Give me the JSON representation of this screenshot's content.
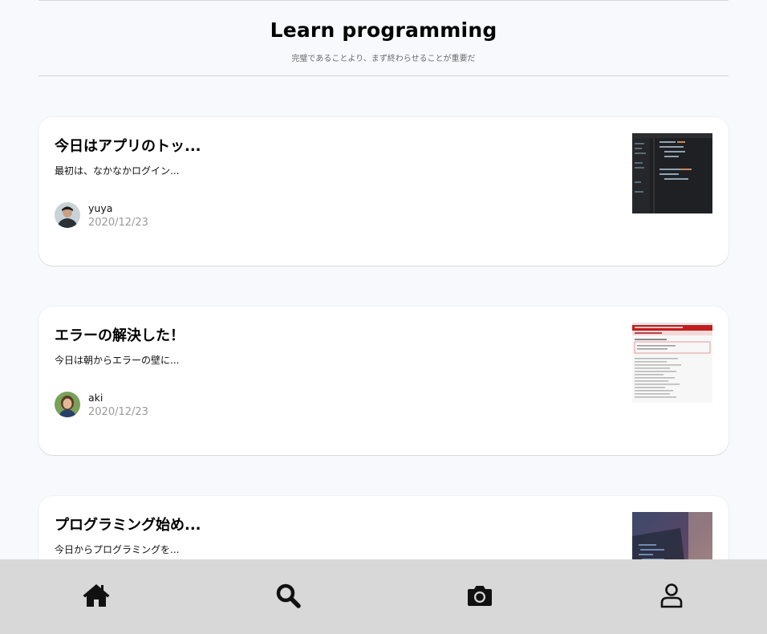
{
  "header": {
    "title": "Learn programming",
    "subtitle": "完璧であることより、まず終わらせることが重要だ"
  },
  "posts": [
    {
      "title": "今日はアプリのトッ...",
      "excerpt": "最初は、なかなかログイン...",
      "author": "yuya",
      "date": "2020/12/23",
      "thumbnail": "code-editor-screenshot"
    },
    {
      "title": "エラーの解決した！",
      "excerpt": "今日は朝からエラーの壁に...",
      "author": "aki",
      "date": "2020/12/23",
      "thumbnail": "error-page-screenshot"
    },
    {
      "title": "プログラミング始め...",
      "excerpt": "今日からプログラミングを...",
      "thumbnail": "laptop-photo"
    }
  ],
  "bottom_nav": {
    "items": [
      "home-icon",
      "search-icon",
      "camera-icon",
      "user-icon"
    ]
  },
  "colors": {
    "background": "#f8f9fd",
    "card": "#ffffff",
    "nav_bar": "#d8d8d8",
    "date_text": "#9a9a9a"
  }
}
